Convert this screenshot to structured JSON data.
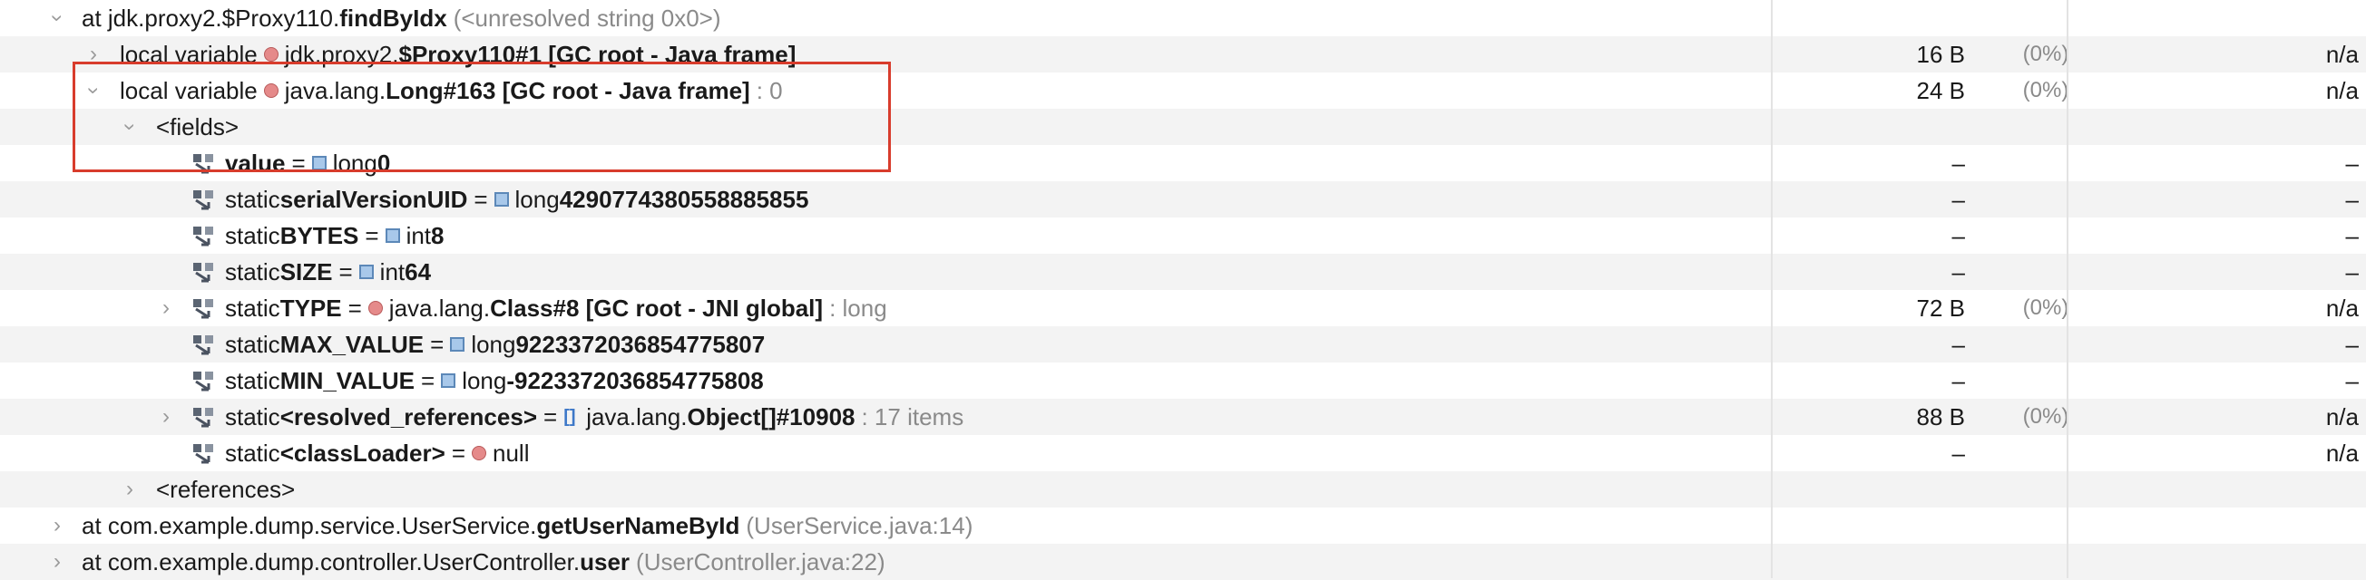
{
  "colors": {
    "highlight": "#d83c2c",
    "object_dot": "#e58a8a",
    "primitive_square": "#a8c8ea",
    "array_icon": "#3d78c8"
  },
  "rows": [
    {
      "depth": 0,
      "chevron": "expanded",
      "parts": [
        [
          "",
          "at jdk.proxy2.$Proxy110."
        ],
        [
          "bold",
          "findByIdx"
        ],
        [
          "gap",
          ""
        ],
        [
          "muted",
          "(<unresolved string 0x0>)"
        ]
      ]
    },
    {
      "depth": 1,
      "chevron": "collapsed",
      "parts": [
        [
          "",
          "local variable"
        ],
        [
          "gap",
          ""
        ],
        [
          "icon",
          "obj"
        ],
        [
          "",
          "jdk.proxy2."
        ],
        [
          "bold",
          "$Proxy110#1 [GC root - Java frame]"
        ]
      ],
      "size": "16 B",
      "pct": "(0%)",
      "retained": "n/a"
    },
    {
      "depth": 1,
      "chevron": "expanded",
      "parts": [
        [
          "",
          "local variable"
        ],
        [
          "gap",
          ""
        ],
        [
          "icon",
          "obj"
        ],
        [
          "",
          "java.lang."
        ],
        [
          "bold",
          "Long#163 [GC root - Java frame]"
        ],
        [
          "gap",
          ""
        ],
        [
          "muted",
          ": 0"
        ]
      ],
      "size": "24 B",
      "pct": "(0%)",
      "retained": "n/a"
    },
    {
      "depth": 2,
      "chevron": "expanded",
      "parts": [
        [
          "",
          "<fields>"
        ]
      ]
    },
    {
      "depth": 3,
      "field": true,
      "parts": [
        [
          "bold",
          "value"
        ],
        [
          "gap",
          ""
        ],
        [
          "",
          "="
        ],
        [
          "gap",
          ""
        ],
        [
          "icon",
          "prim"
        ],
        [
          "",
          "long "
        ],
        [
          "bold",
          "0"
        ]
      ],
      "size": "–",
      "retained": "–"
    },
    {
      "depth": 3,
      "field": true,
      "parts": [
        [
          "",
          "static "
        ],
        [
          "bold",
          "serialVersionUID"
        ],
        [
          "gap",
          ""
        ],
        [
          "",
          "="
        ],
        [
          "gap",
          ""
        ],
        [
          "icon",
          "prim"
        ],
        [
          "",
          "long "
        ],
        [
          "bold",
          "4290774380558885855"
        ]
      ],
      "size": "–",
      "retained": "–"
    },
    {
      "depth": 3,
      "field": true,
      "parts": [
        [
          "",
          "static "
        ],
        [
          "bold",
          "BYTES"
        ],
        [
          "gap",
          ""
        ],
        [
          "",
          "="
        ],
        [
          "gap",
          ""
        ],
        [
          "icon",
          "prim"
        ],
        [
          "",
          "int "
        ],
        [
          "bold",
          "8"
        ]
      ],
      "size": "–",
      "retained": "–"
    },
    {
      "depth": 3,
      "field": true,
      "parts": [
        [
          "",
          "static "
        ],
        [
          "bold",
          "SIZE"
        ],
        [
          "gap",
          ""
        ],
        [
          "",
          "="
        ],
        [
          "gap",
          ""
        ],
        [
          "icon",
          "prim"
        ],
        [
          "",
          "int "
        ],
        [
          "bold",
          "64"
        ]
      ],
      "size": "–",
      "retained": "–"
    },
    {
      "depth": 3,
      "field": true,
      "chevron": "collapsed",
      "parts": [
        [
          "",
          "static "
        ],
        [
          "bold",
          "TYPE"
        ],
        [
          "gap",
          ""
        ],
        [
          "",
          "="
        ],
        [
          "gap",
          ""
        ],
        [
          "icon",
          "obj"
        ],
        [
          "",
          "java.lang."
        ],
        [
          "bold",
          "Class#8 [GC root - JNI global]"
        ],
        [
          "gap",
          ""
        ],
        [
          "muted",
          ": long"
        ]
      ],
      "size": "72 B",
      "pct": "(0%)",
      "retained": "n/a"
    },
    {
      "depth": 3,
      "field": true,
      "parts": [
        [
          "",
          "static "
        ],
        [
          "bold",
          "MAX_VALUE"
        ],
        [
          "gap",
          ""
        ],
        [
          "",
          "="
        ],
        [
          "gap",
          ""
        ],
        [
          "icon",
          "prim"
        ],
        [
          "",
          "long "
        ],
        [
          "bold",
          "9223372036854775807"
        ]
      ],
      "size": "–",
      "retained": "–"
    },
    {
      "depth": 3,
      "field": true,
      "parts": [
        [
          "",
          "static "
        ],
        [
          "bold",
          "MIN_VALUE"
        ],
        [
          "gap",
          ""
        ],
        [
          "",
          "="
        ],
        [
          "gap",
          ""
        ],
        [
          "icon",
          "prim"
        ],
        [
          "",
          "long "
        ],
        [
          "bold",
          "-9223372036854775808"
        ]
      ],
      "size": "–",
      "retained": "–"
    },
    {
      "depth": 3,
      "field": true,
      "chevron": "collapsed",
      "parts": [
        [
          "",
          "static "
        ],
        [
          "bold",
          "<resolved_references>"
        ],
        [
          "gap",
          ""
        ],
        [
          "",
          "="
        ],
        [
          "gap",
          ""
        ],
        [
          "icon",
          "arr"
        ],
        [
          "",
          "java.lang."
        ],
        [
          "bold",
          "Object[]#10908"
        ],
        [
          "gap",
          ""
        ],
        [
          "muted",
          ": 17 items"
        ]
      ],
      "size": "88 B",
      "pct": "(0%)",
      "retained": "n/a"
    },
    {
      "depth": 3,
      "field": true,
      "parts": [
        [
          "",
          "static "
        ],
        [
          "bold",
          "<classLoader>"
        ],
        [
          "gap",
          ""
        ],
        [
          "",
          "="
        ],
        [
          "gap",
          ""
        ],
        [
          "icon",
          "obj"
        ],
        [
          "",
          "null"
        ]
      ],
      "size": "–",
      "retained": "n/a"
    },
    {
      "depth": 2,
      "chevron": "collapsed",
      "parts": [
        [
          "",
          "<references>"
        ]
      ]
    },
    {
      "depth": 0,
      "chevron": "collapsed",
      "parts": [
        [
          "",
          "at com.example.dump.service.UserService."
        ],
        [
          "bold",
          "getUserNameById"
        ],
        [
          "gap",
          ""
        ],
        [
          "muted",
          "(UserService.java:14)"
        ]
      ]
    },
    {
      "depth": 0,
      "chevron": "collapsed",
      "parts": [
        [
          "",
          "at com.example.dump.controller.UserController."
        ],
        [
          "bold",
          "user"
        ],
        [
          "gap",
          ""
        ],
        [
          "muted",
          "(UserController.java:22)"
        ]
      ]
    }
  ]
}
